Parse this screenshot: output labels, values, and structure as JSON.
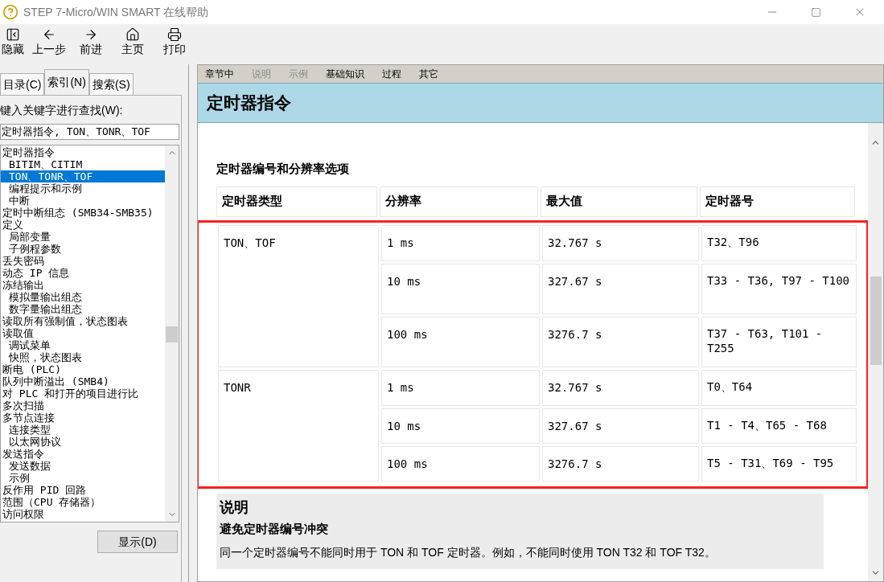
{
  "window": {
    "title": "STEP 7-Micro/WIN SMART 在线帮助"
  },
  "toolbar": [
    {
      "label": "隐藏",
      "kind": "hide"
    },
    {
      "label": "上一步",
      "kind": "back"
    },
    {
      "label": "前进",
      "kind": "forward"
    },
    {
      "label": "主页",
      "kind": "home"
    },
    {
      "label": "打印",
      "kind": "print"
    }
  ],
  "left_tabs": [
    {
      "label": "目录(C)",
      "selected": false
    },
    {
      "label": "索引(N)",
      "selected": true
    },
    {
      "label": "搜索(S)",
      "selected": false
    }
  ],
  "keyword_label": "键入关键字进行查找(W):",
  "keyword_field": {
    "value": "定时器指令, TON、TONR、TOF"
  },
  "index_items": [
    {
      "label": "定时器指令",
      "selected": false,
      "children": [
        {
          "label": "BITIM、CITIM",
          "selected": false
        },
        {
          "label": "TON、TONR、TOF",
          "selected": true
        },
        {
          "label": "编程提示和示例",
          "selected": false
        },
        {
          "label": "中断",
          "selected": false
        }
      ]
    },
    {
      "label": "定时中断组态 (SMB34-SMB35)",
      "selected": false
    },
    {
      "label": "定义",
      "selected": false,
      "children": [
        {
          "label": "局部变量",
          "selected": false
        },
        {
          "label": "子例程参数",
          "selected": false
        }
      ]
    },
    {
      "label": "丢失密码",
      "selected": false
    },
    {
      "label": "动态 IP 信息",
      "selected": false
    },
    {
      "label": "冻结输出",
      "selected": false,
      "children": [
        {
          "label": "模拟量输出组态",
          "selected": false
        },
        {
          "label": "数字量输出组态",
          "selected": false
        }
      ]
    },
    {
      "label": "读取所有强制值，状态图表",
      "selected": false
    },
    {
      "label": "读取值",
      "selected": false,
      "children": [
        {
          "label": "调试菜单",
          "selected": false
        },
        {
          "label": "快照，状态图表",
          "selected": false
        }
      ]
    },
    {
      "label": "断电 (PLC)",
      "selected": false
    },
    {
      "label": "队列中断溢出 (SMB4)",
      "selected": false
    },
    {
      "label": "对 PLC 和打开的项目进行比",
      "selected": false
    },
    {
      "label": "多次扫描",
      "selected": false
    },
    {
      "label": "多节点连接",
      "selected": false,
      "children": [
        {
          "label": "连接类型",
          "selected": false
        },
        {
          "label": "以太网协议",
          "selected": false
        }
      ]
    },
    {
      "label": "发送指令",
      "selected": false,
      "children": [
        {
          "label": "发送数据",
          "selected": false
        },
        {
          "label": "示例",
          "selected": false
        }
      ]
    },
    {
      "label": "反作用 PID 回路",
      "selected": false
    },
    {
      "label": "范围（CPU 存储器）",
      "selected": false
    },
    {
      "label": "访问权限",
      "selected": false
    }
  ],
  "display_button": "显示(D)",
  "nav_links": [
    {
      "label": "章节中",
      "disabled": false
    },
    {
      "label": "说明",
      "disabled": true
    },
    {
      "label": "示例",
      "disabled": true
    },
    {
      "label": "基础知识",
      "disabled": false
    },
    {
      "label": "过程",
      "disabled": false
    },
    {
      "label": "其它",
      "disabled": false
    }
  ],
  "page_title": "定时器指令",
  "section_title": "定时器编号和分辨率选项",
  "table": {
    "columns": [
      "定时器类型",
      "分辨率",
      "最大值",
      "定时器号"
    ],
    "highlighted": true,
    "groups": [
      {
        "type": "TON、TOF",
        "rows": [
          {
            "resolution": "1 ms",
            "max": "32.767 s",
            "numbers": "T32、T96"
          },
          {
            "resolution": "10 ms",
            "max": "327.67 s",
            "numbers": "T33 - T36, T97 - T100"
          },
          {
            "resolution": "100 ms",
            "max": "3276.7 s",
            "numbers": "T37 - T63, T101 - T255"
          }
        ]
      },
      {
        "type": "TONR",
        "rows": [
          {
            "resolution": "1 ms",
            "max": "32.767 s",
            "numbers": "T0、T64"
          },
          {
            "resolution": "10 ms",
            "max": "327.67 s",
            "numbers": "T1 - T4、T65 - T68"
          },
          {
            "resolution": "100 ms",
            "max": "3276.7 s",
            "numbers": "T5 - T31、T69 - T95"
          }
        ]
      }
    ]
  },
  "note": {
    "heading": "说明",
    "subheading": "避免定时器编号冲突",
    "text": "同一个定时器编号不能同时用于 TON 和 TOF 定时器。例如，不能同时使用 TON T32 和 TOF T32。"
  }
}
